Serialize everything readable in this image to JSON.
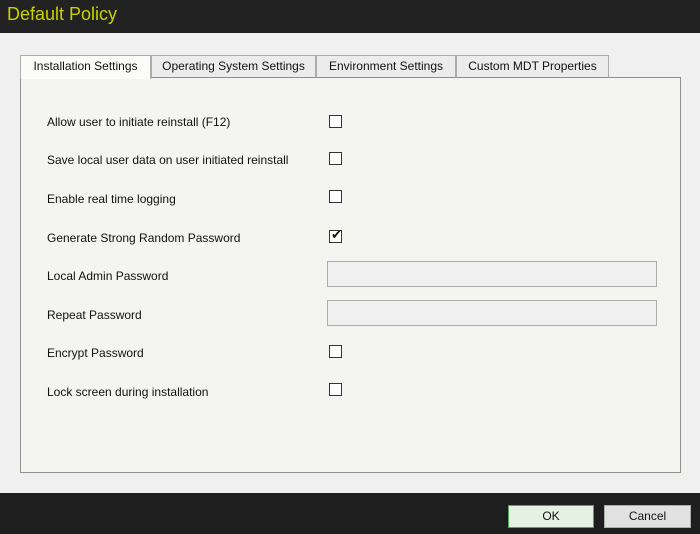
{
  "window": {
    "title": "Default Policy"
  },
  "tabs": [
    {
      "label": "Installation Settings",
      "active": true
    },
    {
      "label": "Operating System Settings",
      "active": false
    },
    {
      "label": "Environment Settings",
      "active": false
    },
    {
      "label": "Custom MDT Properties",
      "active": false
    }
  ],
  "settings": {
    "allow_reinstall": {
      "label": "Allow user to initiate reinstall (F12)",
      "checked": false
    },
    "save_local_data": {
      "label": "Save local user data on user initiated reinstall",
      "checked": false
    },
    "realtime_logging": {
      "label": "Enable real time logging",
      "checked": false
    },
    "strong_password": {
      "label": "Generate Strong Random Password",
      "checked": true,
      "check_glyph": "✔"
    },
    "admin_password": {
      "label": "Local Admin Password",
      "value": ""
    },
    "repeat_password": {
      "label": "Repeat Password",
      "value": ""
    },
    "encrypt_password": {
      "label": "Encrypt Password",
      "checked": false
    },
    "lock_screen": {
      "label": "Lock screen during installation",
      "checked": false
    }
  },
  "buttons": {
    "ok": "OK",
    "cancel": "Cancel"
  },
  "colors": {
    "title_accent": "#c9d200",
    "ok_border": "#4fa85d"
  }
}
